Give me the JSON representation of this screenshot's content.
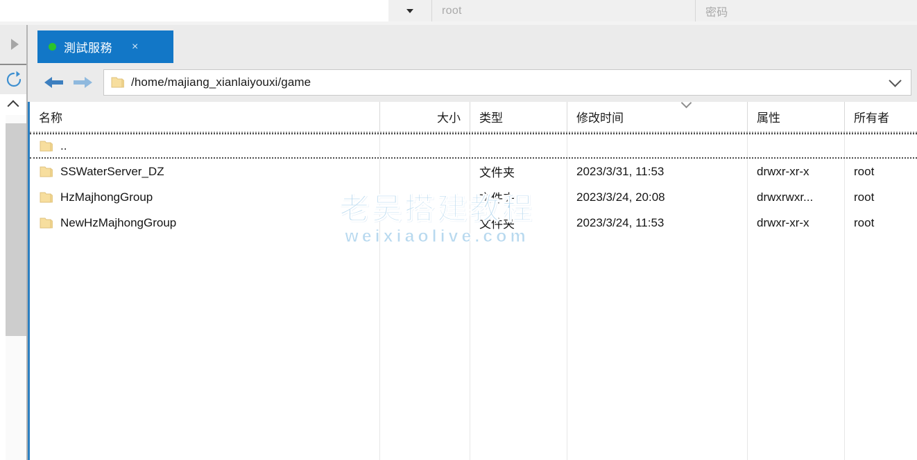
{
  "topbar": {
    "dropdown_icon": "caret-down-icon",
    "username_value": "root",
    "password_placeholder": "密码"
  },
  "left_rail": {
    "expand_icon": "triangle-right-icon",
    "refresh_icon": "refresh-icon",
    "scroll_up_icon": "chevron-up-icon"
  },
  "tab": {
    "status_dot": "green-status-dot-icon",
    "label": "測試服務",
    "close_label": "×"
  },
  "addressbar": {
    "back_icon": "arrow-left-icon",
    "forward_icon": "arrow-right-icon",
    "folder_icon": "folder-icon",
    "path": "/home/majiang_xianlaiyouxi/game",
    "dropdown_icon": "chevron-down-icon"
  },
  "file_list": {
    "columns": [
      {
        "key": "name",
        "label": "名称",
        "align": "left"
      },
      {
        "key": "size",
        "label": "大小",
        "align": "right"
      },
      {
        "key": "type",
        "label": "类型",
        "align": "left"
      },
      {
        "key": "mtime",
        "label": "修改时间",
        "align": "left"
      },
      {
        "key": "attr",
        "label": "属性",
        "align": "left"
      },
      {
        "key": "owner",
        "label": "所有者",
        "align": "left"
      }
    ],
    "sort": {
      "column": "mtime",
      "direction": "descending",
      "icon": "chevron-down-icon"
    },
    "rows": [
      {
        "name": "..",
        "size": "",
        "type": "",
        "mtime": "",
        "attr": "",
        "owner": "",
        "icon": "folder-icon",
        "focused": true
      },
      {
        "name": "SSWaterServer_DZ",
        "size": "",
        "type": "文件夹",
        "mtime": "2023/3/31, 11:53",
        "attr": "drwxr-xr-x",
        "owner": "root",
        "icon": "folder-icon",
        "focused": false
      },
      {
        "name": "HzMajhongGroup",
        "size": "",
        "type": "文件夹",
        "mtime": "2023/3/24, 20:08",
        "attr": "drwxrwxr...",
        "owner": "root",
        "icon": "folder-icon",
        "focused": false
      },
      {
        "name": "NewHzMajhongGroup",
        "size": "",
        "type": "文件夹",
        "mtime": "2023/3/24, 11:53",
        "attr": "drwxr-xr-x",
        "owner": "root",
        "icon": "folder-icon",
        "focused": false
      }
    ]
  },
  "watermark": {
    "main": "老吴搭建教程",
    "sub": "weixiaolive.com"
  },
  "colors": {
    "tab_active": "#1277c7",
    "panel_border": "#2b7fc1",
    "status_dot": "#2bc42b",
    "folder": "#f5dc9a",
    "watermark": "#b8d9ef"
  }
}
